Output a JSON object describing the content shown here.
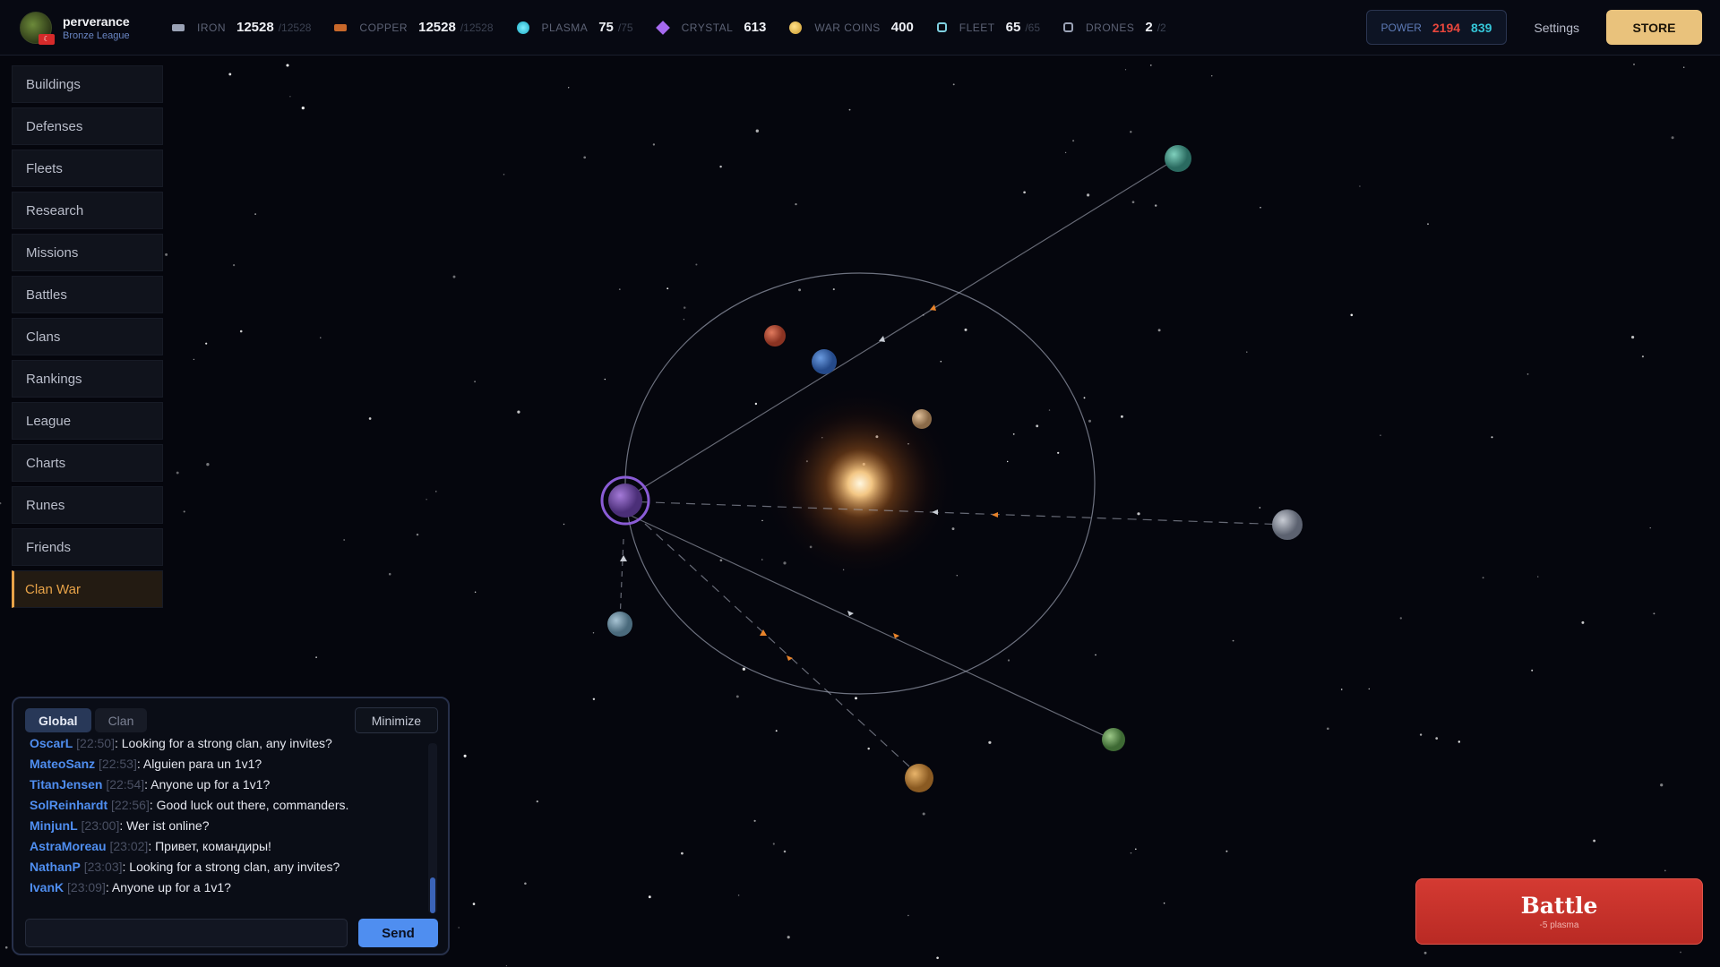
{
  "player": {
    "name": "perverance",
    "league": "Bronze League"
  },
  "resources": [
    {
      "key": "iron",
      "label": "IRON",
      "value": "12528",
      "cap": "/12528",
      "icon": "iron-icon"
    },
    {
      "key": "copper",
      "label": "COPPER",
      "value": "12528",
      "cap": "/12528",
      "icon": "copper-icon"
    },
    {
      "key": "plasma",
      "label": "PLASMA",
      "value": "75",
      "cap": "/75",
      "icon": "plasma-icon"
    },
    {
      "key": "crystal",
      "label": "CRYSTAL",
      "value": "613",
      "cap": "",
      "icon": "crystal-icon"
    },
    {
      "key": "coin",
      "label": "WAR COINS",
      "value": "400",
      "cap": "",
      "icon": "coin-icon"
    },
    {
      "key": "fleet",
      "label": "FLEET",
      "value": "65",
      "cap": "/65",
      "icon": "fleet-icon"
    },
    {
      "key": "drone",
      "label": "DRONES",
      "value": "2",
      "cap": "/2",
      "icon": "drone-icon"
    }
  ],
  "power": {
    "label": "POWER",
    "value_red": "2194",
    "value_cyan": "839"
  },
  "header": {
    "settings_label": "Settings",
    "store_label": "STORE"
  },
  "nav": [
    {
      "label": "Buildings",
      "active": false
    },
    {
      "label": "Defenses",
      "active": false
    },
    {
      "label": "Fleets",
      "active": false
    },
    {
      "label": "Research",
      "active": false
    },
    {
      "label": "Missions",
      "active": false
    },
    {
      "label": "Battles",
      "active": false
    },
    {
      "label": "Clans",
      "active": false
    },
    {
      "label": "Rankings",
      "active": false
    },
    {
      "label": "League",
      "active": false
    },
    {
      "label": "Charts",
      "active": false
    },
    {
      "label": "Runes",
      "active": false
    },
    {
      "label": "Friends",
      "active": false
    },
    {
      "label": "Clan War",
      "active": true
    }
  ],
  "chat": {
    "tabs": [
      "Global",
      "Clan"
    ],
    "minimize_label": "Minimize",
    "send_label": "Send",
    "input_value": "",
    "messages": [
      {
        "user": "OscarL",
        "time": "[22:50]",
        "text": ": Looking for a strong clan, any invites?"
      },
      {
        "user": "MateoSanz",
        "time": "[22:53]",
        "text": ": Alguien para un 1v1?"
      },
      {
        "user": "TitanJensen",
        "time": "[22:54]",
        "text": ": Anyone up for a 1v1?"
      },
      {
        "user": "SolReinhardt",
        "time": "[22:56]",
        "text": ": Good luck out there, commanders."
      },
      {
        "user": "MinjunL",
        "time": "[23:00]",
        "text": ": Wer ist online?"
      },
      {
        "user": "AstraMoreau",
        "time": "[23:02]",
        "text": ": Привет, командиры!"
      },
      {
        "user": "NathanP",
        "time": "[23:03]",
        "text": ": Looking for a strong clan, any invites?"
      },
      {
        "user": "IvanK",
        "time": "[23:09]",
        "text": ": Anyone up for a 1v1?"
      }
    ]
  },
  "battle": {
    "label": "Battle",
    "cost": "-5 plasma"
  },
  "colors": {
    "accent_gold": "#e9c27c",
    "active_nav": "#e8a348",
    "battle_red": "#d43a32",
    "chat_user_blue": "#4f8ef0",
    "power_red": "#e8463c",
    "power_cyan": "#35c6d8"
  }
}
